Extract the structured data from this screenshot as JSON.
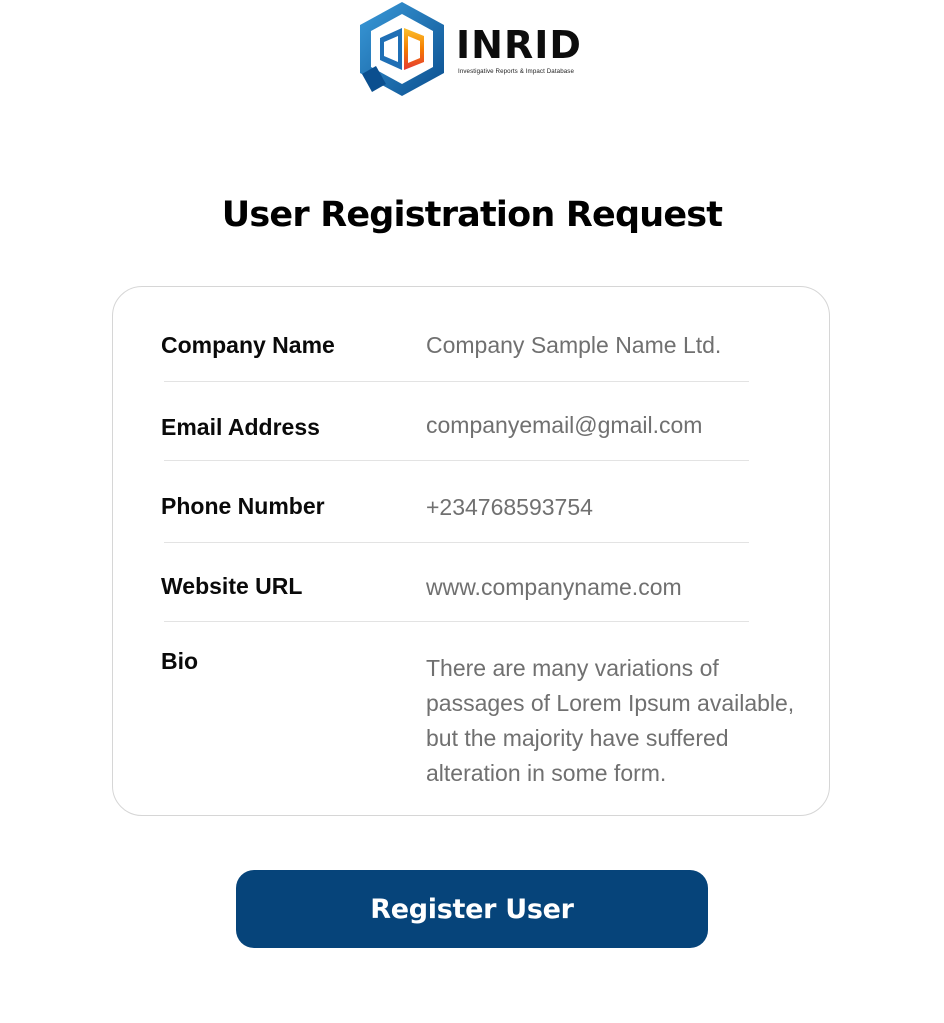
{
  "brand": {
    "name": "INRID",
    "tagline": "Investigative Reports & Impact Database",
    "colors": {
      "primary": "#06447a",
      "logo_blue": "#1f6fb5",
      "logo_red": "#e53935",
      "logo_orange": "#f57c00",
      "logo_yellow": "#fbc02d"
    },
    "icon": "inrid-hexagon-logo"
  },
  "page": {
    "title": "User Registration Request"
  },
  "form": {
    "fields": [
      {
        "label": "Company Name",
        "value": "Company Sample Name Ltd."
      },
      {
        "label": "Email Address",
        "value": "companyemail@gmail.com"
      },
      {
        "label": "Phone Number",
        "value": "+234768593754"
      },
      {
        "label": "Website URL",
        "value": "www.companyname.com"
      },
      {
        "label": "Bio",
        "value": "There are many variations of passages of Lorem Ipsum available, but the majority have suffered alteration in some form."
      }
    ]
  },
  "actions": {
    "register_label": "Register User"
  }
}
